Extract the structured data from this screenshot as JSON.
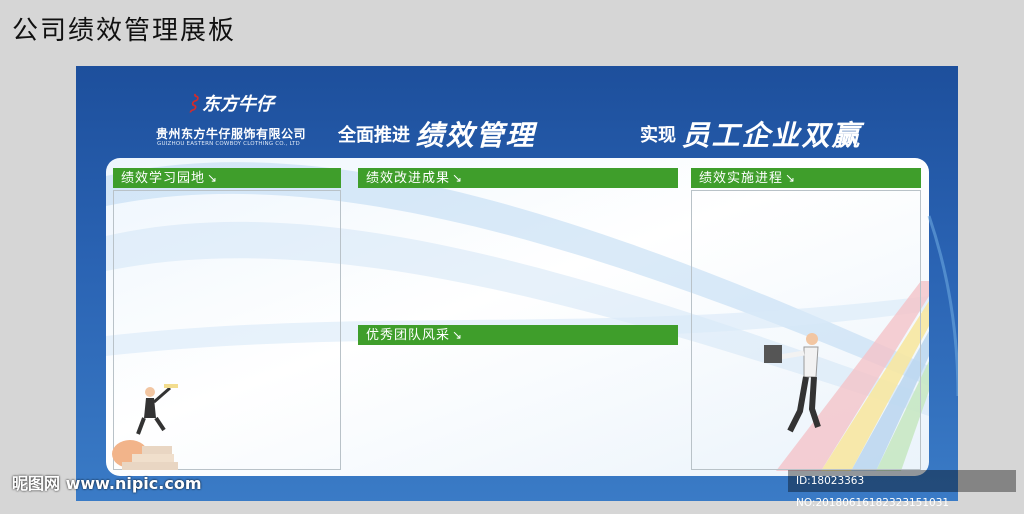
{
  "page": {
    "title": "公司绩效管理展板"
  },
  "logo": {
    "script": "东方牛仔",
    "brand_en": "EASTERNCOWBOY",
    "company_cn": "贵州东方牛仔服饰有限公司",
    "company_en": "GUIZHOU EASTERN COWBOY CLOTHING CO., LTD"
  },
  "slogans": [
    {
      "small": "全面推进",
      "big": "绩效管理"
    },
    {
      "small": "实现",
      "big": "员工企业双赢"
    }
  ],
  "sections": {
    "learning": "绩效学习园地",
    "improvement": "绩效改进成果",
    "team": "优秀团队风采",
    "progress": "绩效实施进程",
    "arrow": "↘"
  },
  "watermark": {
    "site": "昵图网 www.nipic.com",
    "id": "ID:18023363 NO:20180616182323151031"
  },
  "colors": {
    "board_blue": "#1d4f9c",
    "bar_green": "#3f9e2b"
  }
}
